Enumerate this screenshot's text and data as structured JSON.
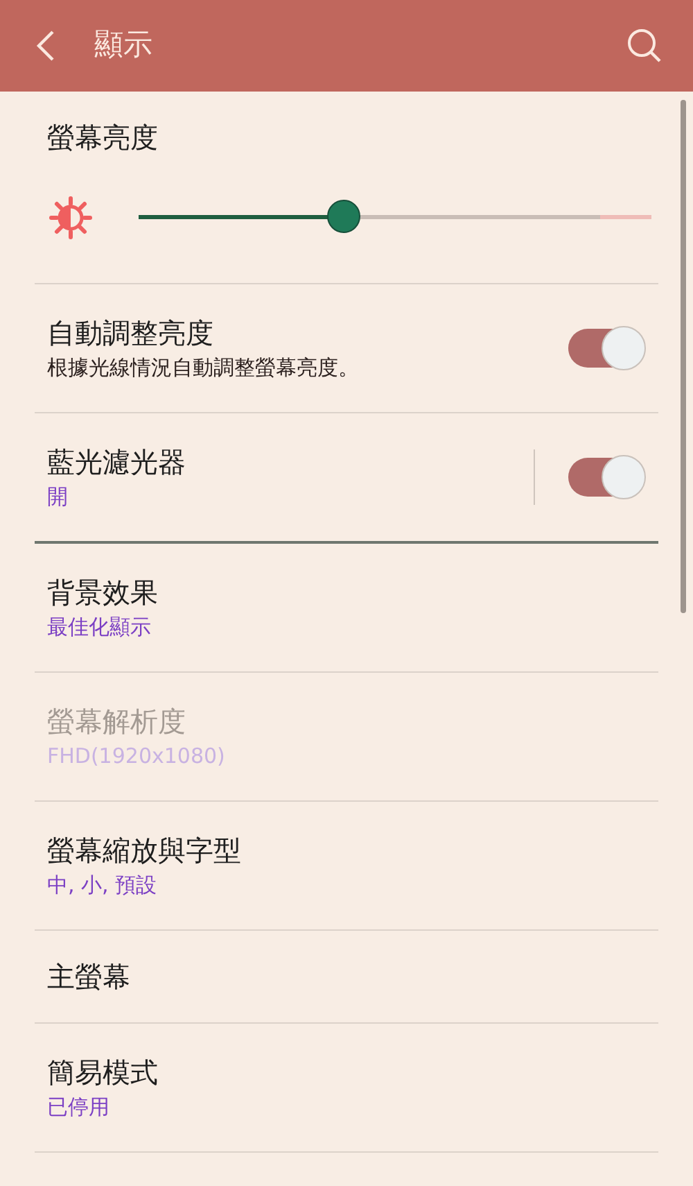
{
  "app_bar": {
    "title": "顯示"
  },
  "groups": [
    {
      "items": [
        {
          "kind": "slider",
          "title": "螢幕亮度",
          "level": 0.4,
          "disabled": false
        },
        {
          "kind": "toggle",
          "title": "自動調整亮度",
          "description": "根據光線情況自動調整螢幕亮度。",
          "on": true,
          "disabled": false
        },
        {
          "kind": "split_toggle",
          "title": "藍光濾光器",
          "summary": "開",
          "on": true,
          "disabled": false
        }
      ]
    },
    {
      "items": [
        {
          "kind": "link",
          "title": "背景效果",
          "summary": "最佳化顯示",
          "disabled": false
        },
        {
          "kind": "link",
          "title": "螢幕解析度",
          "summary": "FHD(1920x1080)",
          "disabled": true
        },
        {
          "kind": "link",
          "title": "螢幕縮放與字型",
          "summary": "中, 小, 預設",
          "disabled": false
        },
        {
          "kind": "link",
          "title": "主螢幕",
          "disabled": false
        },
        {
          "kind": "link",
          "title": "簡易模式",
          "summary": "已停用",
          "disabled": false
        }
      ]
    }
  ]
}
